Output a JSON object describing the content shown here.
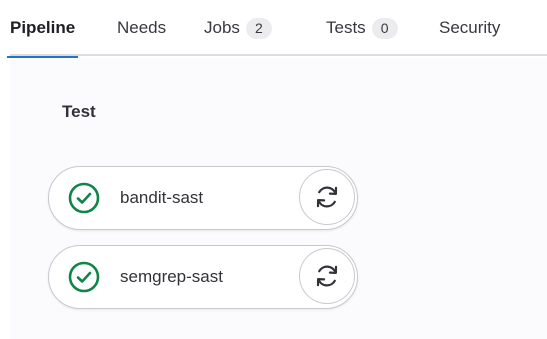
{
  "tabs": [
    {
      "label": "Pipeline",
      "active": true
    },
    {
      "label": "Needs"
    },
    {
      "label": "Jobs",
      "count": "2"
    },
    {
      "label": "Tests",
      "count": "0"
    },
    {
      "label": "Security"
    }
  ],
  "stage": {
    "title": "Test",
    "jobs": [
      {
        "name": "bandit-sast",
        "status_icon": "check-circle-icon",
        "action_icon": "retry-icon"
      },
      {
        "name": "semgrep-sast",
        "status_icon": "check-circle-icon",
        "action_icon": "retry-icon"
      }
    ]
  },
  "colors": {
    "active_tab_underline": "#1f75cb",
    "success": "#108548",
    "panel_bg": "#fbfafd"
  }
}
